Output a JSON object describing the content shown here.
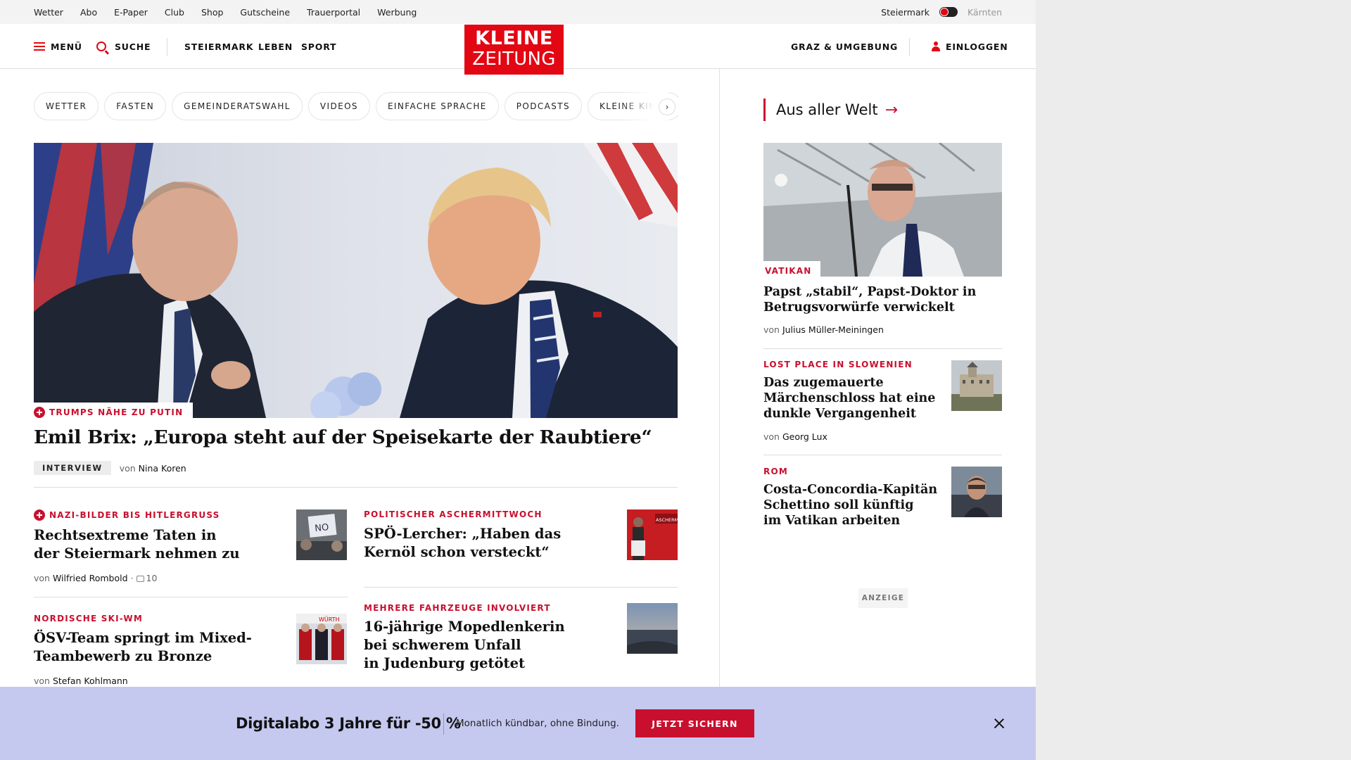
{
  "topbar": {
    "links": [
      "Wetter",
      "Abo",
      "E-Paper",
      "Club",
      "Shop",
      "Gutscheine",
      "Trauerportal",
      "Werbung"
    ],
    "region_active": "Steiermark",
    "region_inactive": "Kärnten"
  },
  "header": {
    "menu_label": "MENÜ",
    "search_label": "SUCHE",
    "nav": [
      "STEIERMARK",
      "LEBEN",
      "SPORT"
    ],
    "logo_line1": "KLEINE",
    "logo_line2": "ZEITUNG",
    "region_link": "GRAZ & UMGEBUNG",
    "login_label": "EINLOGGEN"
  },
  "chips": [
    "WETTER",
    "FASTEN",
    "GEMEINDERATSWAHL",
    "VIDEOS",
    "EINFACHE SPRACHE",
    "PODCASTS",
    "KLEINE KINDE"
  ],
  "chip_next": "›",
  "hero": {
    "kicker": "TRUMPS NÄHE ZU PUTIN",
    "title": "Emil Brix: „Europa steht auf der Speisekarte der Raubtiere“",
    "badge": "INTERVIEW",
    "by": "von",
    "author": "Nina Koren"
  },
  "teasers": [
    {
      "kicker": "NAZI-BILDER BIS HITLERGRUSS",
      "title_l1": "Rechtsextreme Taten in",
      "title_l2": "der Steiermark nehmen zu",
      "by": "von",
      "author": "Wilfried Rombold",
      "comments": "10",
      "thumb": "protest-sign"
    },
    {
      "kicker": "POLITISCHER ASCHERMITTWOCH",
      "title_l1": "SPÖ-Lercher: „Haben das",
      "title_l2": "Kernöl schon versteckt“",
      "thumb_text": "ASCHERMITT"
    },
    {
      "kicker": "NORDISCHE SKI-WM",
      "title_l1": "ÖSV-Team springt im Mixed-",
      "title_l2": "Teambewerb zu Bronze",
      "by": "von",
      "author": "Stefan Kohlmann",
      "thumb_text": "WÜRTH"
    },
    {
      "kicker": "MEHRERE FAHRZEUGE INVOLVIERT",
      "title_l1": "16-jährige Mopedlenkerin",
      "title_l2": "bei schwerem Unfall",
      "title_l3": "in Judenburg getötet"
    }
  ],
  "right": {
    "section_title": "Aus aller Welt",
    "section_arrow": "→",
    "lead": {
      "kicker": "VATIKAN",
      "title": "Papst „stabil“, Papst-Doktor in Betrugsvorwürfe verwickelt",
      "by": "von",
      "author": "Julius Müller-Meiningen"
    },
    "items": [
      {
        "kicker": "LOST PLACE IN SLOWENIEN",
        "title_l1": "Das zugemauerte",
        "title_l2": "Märchenschloss hat eine",
        "title_l3": "dunkle Vergangenheit",
        "by": "von",
        "author": "Georg Lux"
      },
      {
        "kicker": "ROM",
        "title_l1": "Costa-Concordia-Kapitän",
        "title_l2": "Schettino soll künftig",
        "title_l3": "im Vatikan arbeiten"
      }
    ],
    "ad_label": "ANZEIGE"
  },
  "promo": {
    "title": "Digitalabo 3 Jahre für -50 %",
    "subtitle": "Monatlich kündbar, ohne Bindung.",
    "cta": "JETZT SICHERN"
  },
  "colors": {
    "brand_red": "#e30613",
    "kicker_red": "#c8102e",
    "promo_bg": "#c5c9ef"
  }
}
